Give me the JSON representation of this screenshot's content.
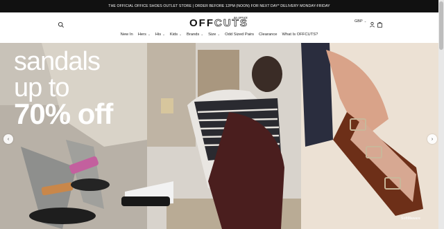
{
  "announcement": "THE OFFICIAL OFFICE SHOES OUTLET STORE | ORDER BEFORE 12PM (NOON) FOR NEXT DAY* DELIVERY MONDAY-FRIDAY",
  "header": {
    "logo_main": "OFF",
    "logo_accent": "CUTS",
    "logo_sub": "BY OFFICE",
    "currency": "GBP",
    "search_icon": "search-icon",
    "account_icon": "user-icon",
    "bag_icon": "shopping-bag-icon"
  },
  "nav": [
    {
      "label": "New In",
      "dropdown": false
    },
    {
      "label": "Hers",
      "dropdown": true
    },
    {
      "label": "His",
      "dropdown": true
    },
    {
      "label": "Kids",
      "dropdown": true
    },
    {
      "label": "Brands",
      "dropdown": true
    },
    {
      "label": "Size",
      "dropdown": true
    },
    {
      "label": "Odd Sized Pairs",
      "dropdown": false
    },
    {
      "label": "Clearance",
      "dropdown": false
    },
    {
      "label": "What Is OFFCUTS?",
      "dropdown": false
    }
  ],
  "hero": {
    "line1": "sandals",
    "line2": "up to",
    "line3": "70% off",
    "prev_icon": "chevron-left-icon",
    "next_icon": "chevron-right-icon"
  },
  "watermark": "SoftMaware",
  "colors": {
    "announce_bg": "#111111",
    "hero_left_bg": "#b7b0a6",
    "hero_right_bg": "#e9dccd",
    "sandal_brown": "#7a3a1f"
  }
}
